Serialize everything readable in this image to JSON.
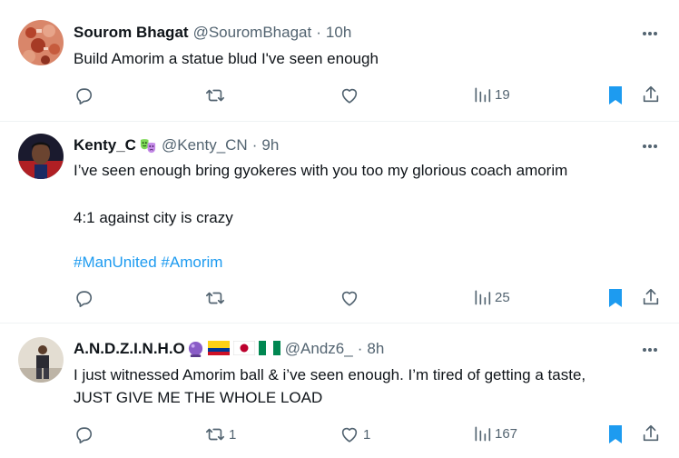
{
  "tweets": [
    {
      "name": "Sourom Bhagat",
      "handle": "@SouromBhagat",
      "separator": "·",
      "time": "10h",
      "text": "Build Amorim a statue blud I've seen enough",
      "replies": "",
      "retweets": "",
      "likes": "",
      "views": "19",
      "avatar_color": "#c85a3a"
    },
    {
      "name": "Kenty_C",
      "handle": "@Kenty_CN",
      "separator": "·",
      "time": "9h",
      "text_lines": [
        "I’ve seen enough bring gyokeres with you too my glorious coach amorim",
        "4:1 against city is crazy"
      ],
      "hashtags": [
        "#ManUnited",
        "#Amorim"
      ],
      "replies": "",
      "retweets": "",
      "likes": "",
      "views": "25",
      "avatar_color": "#b01f24"
    },
    {
      "name": "A.N.D.Z.I.N.H.O",
      "handle": "@Andz6_",
      "separator": "·",
      "time": "8h",
      "text_lines": [
        "I just witnessed Amorim ball & i’ve seen enough. I’m tired of getting a taste,",
        "JUST GIVE ME THE WHOLE LOAD"
      ],
      "replies": "",
      "retweets": "1",
      "likes": "1",
      "views": "167",
      "avatar_color": "#c9c2b8"
    }
  ],
  "colors": {
    "bookmark_active": "#1d9bf0",
    "hashtag": "#1d9bf0",
    "secondary_text": "#536471"
  },
  "icons": [
    "reply-icon",
    "retweet-icon",
    "like-icon",
    "views-icon",
    "bookmark-icon",
    "share-icon",
    "more-icon"
  ]
}
